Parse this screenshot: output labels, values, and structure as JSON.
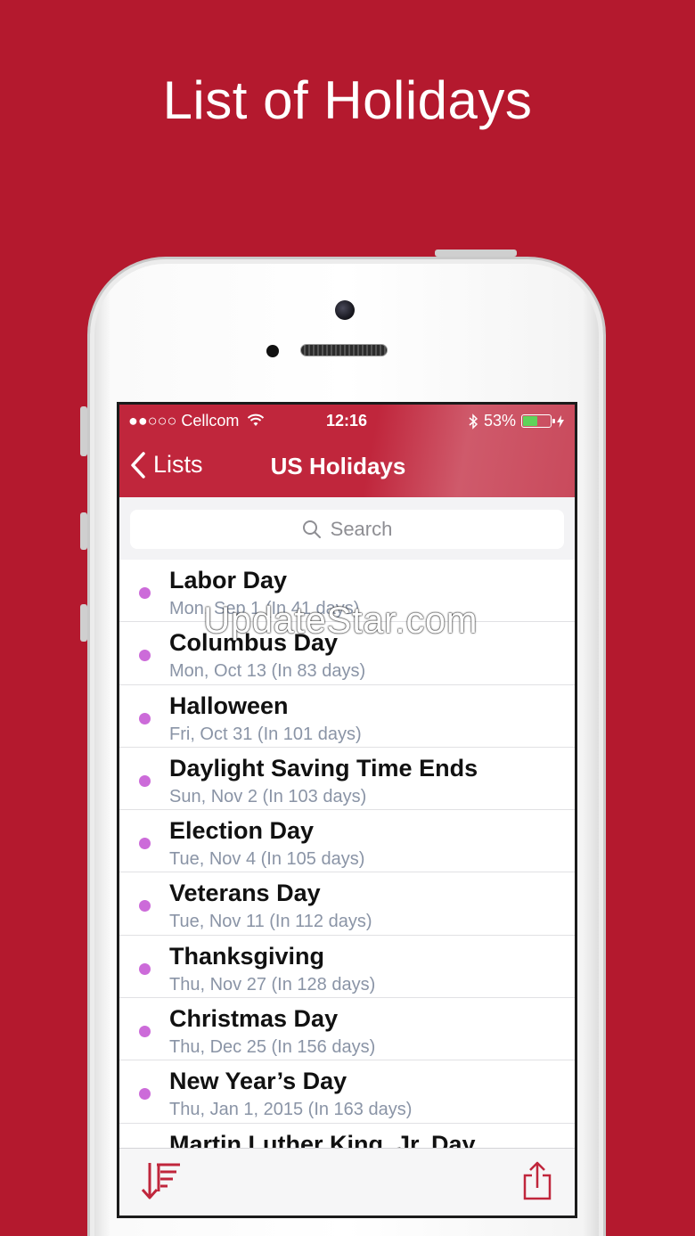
{
  "promo": {
    "title": "List of Holidays"
  },
  "status_bar": {
    "carrier": "●●○○○ Cellcom",
    "time": "12:16",
    "battery": "53%",
    "battery_level": 0.53,
    "battery_color": "#5fd35a"
  },
  "nav": {
    "back_label": "Lists",
    "title": "US Holidays",
    "accent": "#c0263c"
  },
  "search": {
    "placeholder": "Search"
  },
  "holidays": [
    {
      "name": "Labor Day",
      "date": "Mon, Sep 1 (In 41 days)"
    },
    {
      "name": "Columbus Day",
      "date": "Mon, Oct 13 (In 83 days)"
    },
    {
      "name": "Halloween",
      "date": "Fri, Oct 31 (In 101 days)"
    },
    {
      "name": "Daylight Saving Time Ends",
      "date": "Sun, Nov 2 (In 103 days)"
    },
    {
      "name": "Election Day",
      "date": "Tue, Nov 4 (In 105 days)"
    },
    {
      "name": "Veterans Day",
      "date": "Tue, Nov 11 (In 112 days)"
    },
    {
      "name": "Thanksgiving",
      "date": "Thu, Nov 27 (In 128 days)"
    },
    {
      "name": "Christmas Day",
      "date": "Thu, Dec 25 (In 156 days)"
    },
    {
      "name": "New Year’s Day",
      "date": "Thu, Jan 1, 2015 (In 163 days)"
    },
    {
      "name": "Martin Luther King, Jr. Day",
      "date": ""
    }
  ],
  "dot_color": "#cc6bd9",
  "toolbar": {
    "sort_icon": "sort-icon",
    "share_icon": "share-icon"
  },
  "watermark": "UpdateStar.com"
}
